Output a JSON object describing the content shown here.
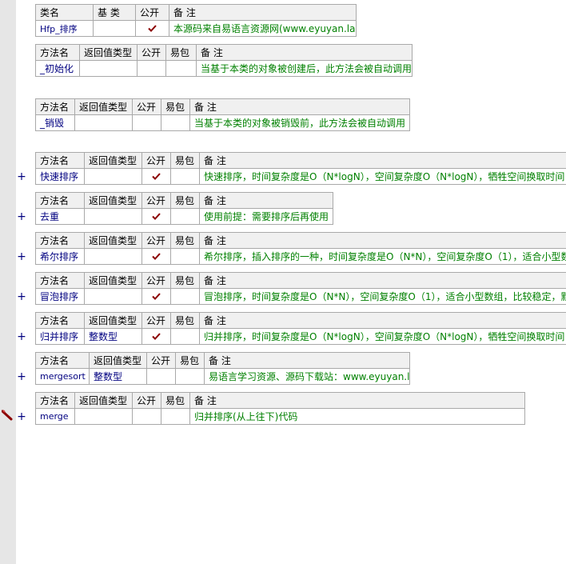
{
  "class_table": {
    "headers": {
      "name": "类名",
      "base": "基 类",
      "public": "公开",
      "note": "备 注"
    },
    "row": {
      "name": "Hfp_排序",
      "base": "",
      "public": true,
      "note": "本源码来自易语言资源网(www.eyuyan.la)"
    }
  },
  "method_headers": {
    "name": "方法名",
    "return_type": "返回值类型",
    "public": "公开",
    "easy_pack": "易包",
    "note": "备 注"
  },
  "methods": [
    {
      "name": "_初始化",
      "return_type": "",
      "public": false,
      "easy_pack": "",
      "note": "当基于本类的对象被创建后，此方法会被自动调用",
      "has_plus": false
    },
    {
      "name": "_销毁",
      "return_type": "",
      "public": false,
      "easy_pack": "",
      "note": "当基于本类的对象被销毁前，此方法会被自动调用",
      "has_plus": false
    },
    {
      "name": "快速排序",
      "return_type": "",
      "public": true,
      "easy_pack": "",
      "note": "快速排序，时间复杂度是O（N*logN），空间复杂度O（N*logN），牺牲空间换取时间，适",
      "has_plus": true
    },
    {
      "name": "去重",
      "return_type": "",
      "public": true,
      "easy_pack": "",
      "note": "使用前提：需要排序后再使用",
      "has_plus": true
    },
    {
      "name": "希尔排序",
      "return_type": "",
      "public": true,
      "easy_pack": "",
      "note": "希尔排序，插入排序的一种，时间复杂度是O（N*N），空间复杂度O（1），适合小型数组",
      "has_plus": true
    },
    {
      "name": "冒泡排序",
      "return_type": "",
      "public": true,
      "easy_pack": "",
      "note": "冒泡排序，时间复杂度是O（N*N），空间复杂度O（1），适合小型数组，比较稳定，默认",
      "has_plus": true
    },
    {
      "name": "归并排序",
      "return_type": "整数型",
      "public": true,
      "easy_pack": "",
      "note": "归并排序，时间复杂度是O（N*logN），空间复杂度O（N*logN），牺牲空间换取时间，适",
      "has_plus": true
    },
    {
      "name": "mergesort",
      "return_type": "整数型",
      "public": false,
      "easy_pack": "",
      "note": "易语言学习资源、源码下载站：www.eyuyan.la",
      "has_plus": true
    },
    {
      "name": "merge",
      "return_type": "",
      "public": false,
      "easy_pack": "",
      "note": "归并排序(从上往下)代码",
      "has_plus": true,
      "breakpoint": true
    }
  ],
  "icons": {
    "check": "checkmark-icon",
    "plus": "expand-plus-icon",
    "breakpoint": "breakpoint-marker-icon"
  },
  "colors": {
    "name": "#000080",
    "note": "#008000",
    "check": "#8b0000",
    "header_bg": "#f0f0f0",
    "border": "#a9a9a9",
    "gutter": "#e6e6e6"
  }
}
